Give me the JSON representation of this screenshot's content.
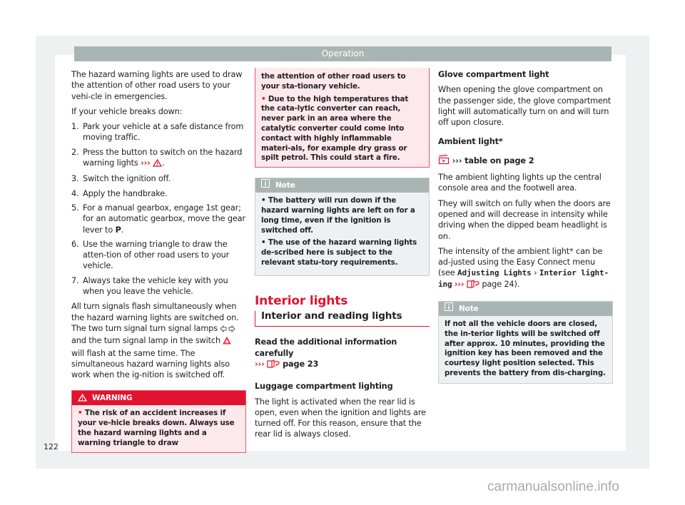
{
  "header": {
    "title": "Operation"
  },
  "page_number": "122",
  "watermark": "carmanualsonline.info",
  "col1": {
    "intro": "The hazard warning lights are used to draw the attention of other road users to your vehi-cle in emergencies.",
    "breakdown_label": "If your vehicle breaks down:",
    "steps": [
      {
        "num": "1.",
        "text": "Park your vehicle at a safe distance from moving traffic."
      },
      {
        "num": "2.",
        "text": "Press the button to switch on the hazard warning lights",
        "ref": "›››"
      },
      {
        "num": "3.",
        "text": "Switch the ignition off."
      },
      {
        "num": "4.",
        "text": "Apply the handbrake."
      },
      {
        "num": "5.",
        "text": "For a manual gearbox, engage 1st gear; for an automatic gearbox, move the gear lever to",
        "bold_end": "P"
      },
      {
        "num": "6.",
        "text": "Use the warning triangle to draw the atten-tion of other road users to your vehicle."
      },
      {
        "num": "7.",
        "text": "Always take the vehicle key with you when you leave the vehicle."
      }
    ],
    "turn_signals_a": "All turn signals flash simultaneously when the hazard warning lights are switched on. The two turn signal turn signal lamps",
    "turn_signals_b": "and the turn signal lamp in the switch",
    "turn_signals_c": "will flash at the same time. The simultaneous hazard warning lights also work when the ig-nition is switched off.",
    "warning": {
      "title": "WARNING",
      "bullet1_part1": "The risk of an accident increases if your ve-hicle breaks down. Always use the hazard warning lights and a warning triangle to draw"
    }
  },
  "col2": {
    "warning_cont": {
      "bullet1_part2": "the attention of other road users to your sta-tionary vehicle.",
      "bullet2": "Due to the high temperatures that the cata-lytic converter can reach, never park in an area where the catalytic converter could come into contact with highly inflammable materi-als, for example dry grass or spilt petrol. This could start a fire."
    },
    "note": {
      "title": "Note",
      "items": [
        "The battery will run down if the hazard warning lights are left on for a long time, even if the ignition is switched off.",
        "The use of the hazard warning lights de-scribed here is subject to the relevant statu-tory requirements."
      ]
    },
    "section_title": "Interior lights",
    "subsection_title": "Interior and reading lights",
    "read_more": "Read the additional information carefully",
    "read_more_ref": "›››",
    "read_more_page": "page 23",
    "luggage_title": "Luggage compartment lighting",
    "luggage_text": "The light is activated when the rear lid is open, even when the ignition and lights are turned off. For this reason, ensure that the rear lid is always closed."
  },
  "col3": {
    "glove_title": "Glove compartment light",
    "glove_text": "When opening the glove compartment on the passenger side, the glove compartment light will automatically turn on and will turn off upon closure.",
    "ambient_title": "Ambient light*",
    "ambient_ref": "››› table on page 2",
    "ambient_text1": "The ambient lighting lights up the central console area and the footwell area.",
    "ambient_text2": "They will switch on fully when the doors are opened and will decrease in intensity while driving when the dipped beam headlight is on.",
    "intensity_text": "The intensity of the ambient light* can be ad-justed using the Easy Connect menu (see",
    "menu_path_1": "Adjusting Lights",
    "menu_sep": "›",
    "menu_path_2": "Interior light-ing",
    "intensity_ref": "›››",
    "intensity_page": "page 24",
    "intensity_end": ").",
    "note": {
      "title": "Note",
      "text": "If not all the vehicle doors are closed, the in-terior lights will be switched off after approx. 10 minutes, providing the ignition key has been removed and the courtesy light position selected. This prevents the battery from dis-charging."
    }
  },
  "colors": {
    "accent": "#e2132e",
    "header_bg": "#a9b5b3",
    "warning_bg": "#fde8ec",
    "note_bg": "#eef1f2"
  }
}
